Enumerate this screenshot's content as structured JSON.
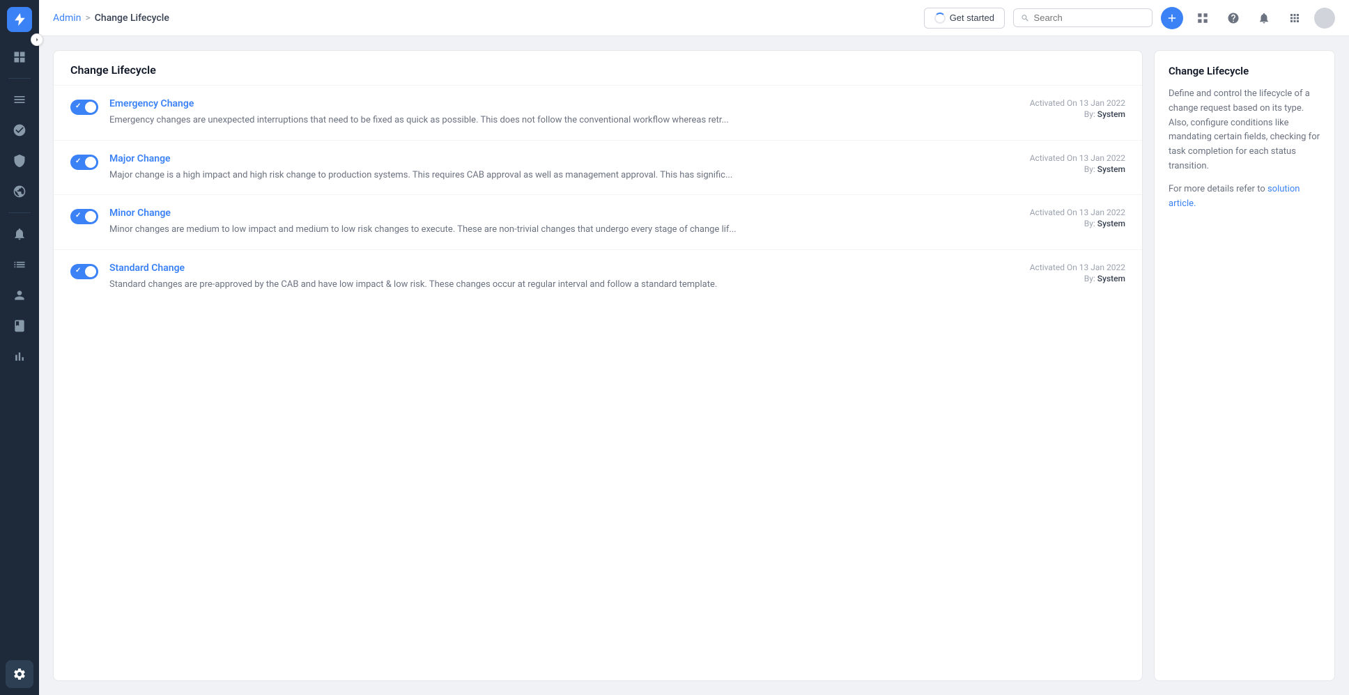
{
  "app": {
    "logo_icon": "lightning-icon"
  },
  "sidebar": {
    "items": [
      {
        "id": "dashboard",
        "icon": "grid-icon",
        "active": false
      },
      {
        "id": "menu",
        "icon": "menu-icon",
        "active": false
      },
      {
        "id": "chart",
        "icon": "chart-icon",
        "active": false
      },
      {
        "id": "shield",
        "icon": "shield-icon",
        "active": false
      },
      {
        "id": "globe",
        "icon": "globe-icon",
        "active": false
      },
      {
        "id": "alert",
        "icon": "alert-icon",
        "active": false
      },
      {
        "id": "list",
        "icon": "list-icon",
        "active": false
      },
      {
        "id": "person",
        "icon": "person-icon",
        "active": false
      },
      {
        "id": "book",
        "icon": "book-icon",
        "active": false
      },
      {
        "id": "bar-chart",
        "icon": "bar-chart-icon",
        "active": false
      },
      {
        "id": "settings",
        "icon": "settings-icon",
        "active": true
      }
    ]
  },
  "topbar": {
    "breadcrumb_admin": "Admin",
    "breadcrumb_sep": ">",
    "breadcrumb_current": "Change Lifecycle",
    "get_started_label": "Get started",
    "search_placeholder": "Search",
    "search_value": "Search"
  },
  "main_panel": {
    "title": "Change Lifecycle",
    "items": [
      {
        "id": "emergency",
        "title": "Emergency Change",
        "desc": "Emergency changes are unexpected interruptions that need to be fixed as quick as possible. This does not follow the conventional workflow whereas retr...",
        "activated_on": "Activated On 13 Jan 2022",
        "by": "By: System",
        "by_value": "System",
        "enabled": true
      },
      {
        "id": "major",
        "title": "Major Change",
        "desc": "Major change is a high impact and high risk change to production systems. This requires CAB approval as well as management approval. This has signific...",
        "activated_on": "Activated On 13 Jan 2022",
        "by": "By: System",
        "by_value": "System",
        "enabled": true
      },
      {
        "id": "minor",
        "title": "Minor Change",
        "desc": "Minor changes are medium to low impact and medium to low risk changes to execute. These are non-trivial changes that undergo every stage of change lif...",
        "activated_on": "Activated On 13 Jan 2022",
        "by": "By: System",
        "by_value": "System",
        "enabled": true
      },
      {
        "id": "standard",
        "title": "Standard Change",
        "desc": "Standard changes are pre-approved by the CAB and have low impact & low risk. These changes occur at regular interval and follow a standard template.",
        "activated_on": "Activated On 13 Jan 2022",
        "by": "By: System",
        "by_value": "System",
        "enabled": true
      }
    ]
  },
  "right_panel": {
    "title": "Change Lifecycle",
    "description": "Define and control the lifecycle of a change request based on its type. Also, configure conditions like mandating certain fields, checking for task completion for each status transition.",
    "more_details_prefix": "For more details refer to ",
    "solution_article_label": "solution article.",
    "solution_article_url": "#"
  }
}
